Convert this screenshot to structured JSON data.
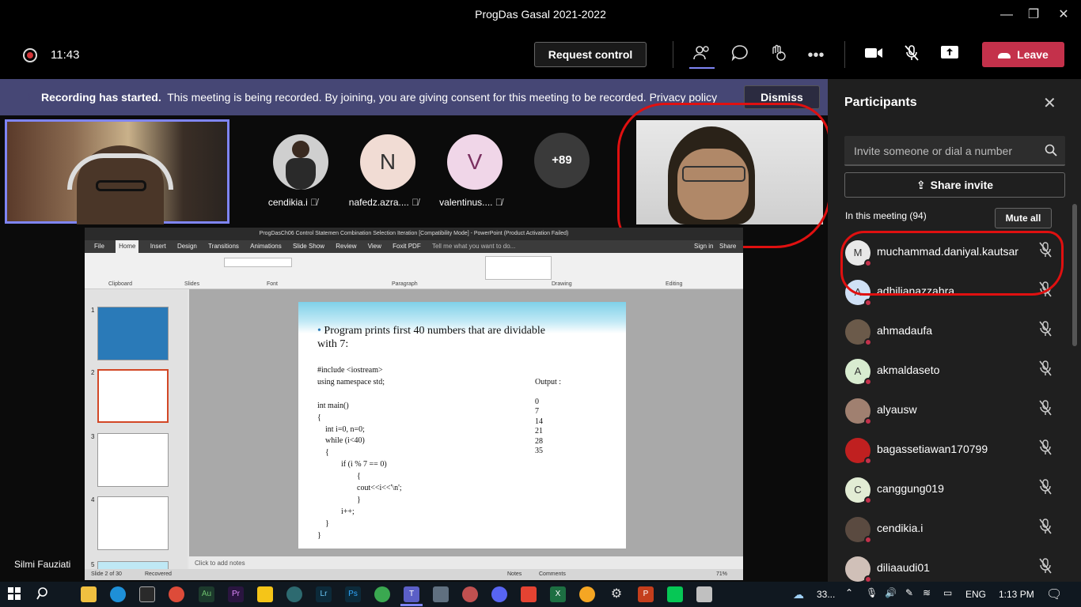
{
  "window": {
    "title": "ProgDas Gasal 2021-2022",
    "min": "—",
    "max": "❐",
    "close": "✕"
  },
  "meeting_bar": {
    "timer": "11:43",
    "request_control": "Request control",
    "leave": "Leave"
  },
  "banner": {
    "bold": "Recording has started.",
    "text": "This meeting is being recorded. By joining, you are giving consent for this meeting to be recorded.",
    "link": "Privacy policy",
    "dismiss": "Dismiss"
  },
  "stage": {
    "presenter_name": "Silmi Fauziati",
    "attendees": [
      {
        "initial": "",
        "name": "cendikia.i",
        "color": "#cfcfcf"
      },
      {
        "initial": "N",
        "name": "nafedz.azra....",
        "color": "#f1dcd4"
      },
      {
        "initial": "V",
        "name": "valentinus....",
        "color": "#f0d6e8"
      }
    ],
    "overflow": "+89"
  },
  "powerpoint": {
    "title": "ProgDasCh06 Control Statemen Combination  Selection Iteration [Compatibility Mode] - PowerPoint (Product Activation Failed)",
    "tabs": [
      "File",
      "Home",
      "Insert",
      "Design",
      "Transitions",
      "Animations",
      "Slide Show",
      "Review",
      "View",
      "Foxit PDF",
      "Tell me what you want to do..."
    ],
    "groups": [
      "Clipboard",
      "Slides",
      "Font",
      "Paragraph",
      "Drawing",
      "Editing"
    ],
    "sign_in": "Sign in",
    "share": "Share",
    "slide_bullet": "Program prints first 40 numbers that are dividable with 7:",
    "code": [
      "#include <iostream>",
      "using namespace std;",
      "",
      "int main()",
      "{",
      "    int i=0, n=0;",
      "    while (i<40)",
      "    {",
      "            if (i % 7 == 0)",
      "                    {",
      "                    cout<<i<<'\\n';",
      "                    }",
      "            i++;",
      "    }",
      "}"
    ],
    "output_label": "Output :",
    "output_values": [
      "0",
      "7",
      "14",
      "21",
      "28",
      "35"
    ],
    "notes_placeholder": "Click to add notes",
    "status_left": "Slide 2 of 30",
    "status_recovered": "Recovered",
    "status_notes": "Notes",
    "status_comments": "Comments",
    "zoom": "71%",
    "thumb_numbers": [
      "1",
      "2",
      "3",
      "4",
      "5"
    ]
  },
  "participants": {
    "title": "Participants",
    "search_placeholder": "Invite someone or dial a number",
    "share_invite": "Share invite",
    "in_meeting": "In this meeting (94)",
    "mute_all": "Mute all",
    "people": [
      {
        "initial": "M",
        "name": "muchammad.daniyal.kautsar",
        "color": "#e8e8e8"
      },
      {
        "initial": "A",
        "name": "adhilianazzahra",
        "color": "#cfe0f5"
      },
      {
        "initial": "",
        "name": "ahmadaufa",
        "color": "#6b5a4a"
      },
      {
        "initial": "A",
        "name": "akmaldaseto",
        "color": "#d8ecd0"
      },
      {
        "initial": "",
        "name": "alyausw",
        "color": "#a08070"
      },
      {
        "initial": "",
        "name": "bagassetiawan170799",
        "color": "#c02020"
      },
      {
        "initial": "C",
        "name": "canggung019",
        "color": "#e2ecd4"
      },
      {
        "initial": "",
        "name": "cendikia.i",
        "color": "#5a4a40"
      },
      {
        "initial": "",
        "name": "diliaaudi01",
        "color": "#d0c0b8"
      }
    ]
  },
  "taskbar": {
    "weather": "33...",
    "lang": "ENG",
    "time": "1:13 PM"
  }
}
